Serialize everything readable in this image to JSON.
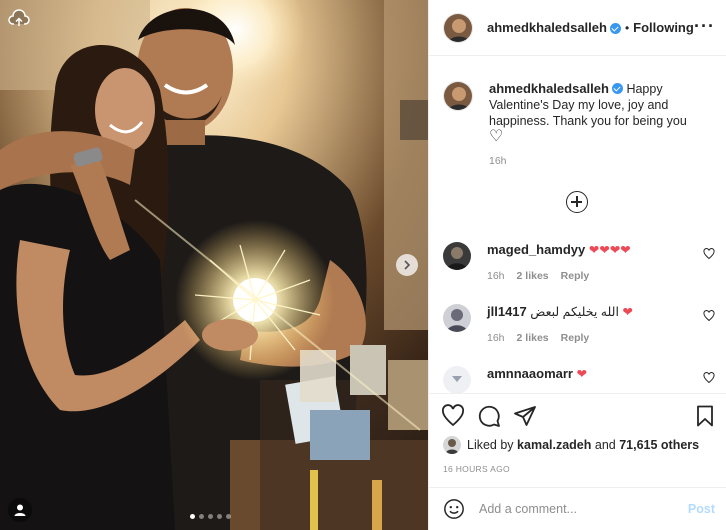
{
  "post": {
    "author": "ahmedkhaledsalleh",
    "follow_status": "Following",
    "more_icon": "more-horizontal-icon",
    "caption": {
      "author": "ahmedkhaledsalleh",
      "text": "Happy Valentine's Day my love, joy and happiness. Thank you for being you",
      "emoji": "♡",
      "time": "16h"
    },
    "load_more_icon": "plus-circle-icon",
    "comments": [
      {
        "author": "maged_hamdyy",
        "text": "",
        "emoji": "❤❤❤❤",
        "time": "16h",
        "likes": "2 likes",
        "reply": "Reply"
      },
      {
        "author": "jll1417",
        "text": "الله يخليكم لبعض",
        "emoji": "❤",
        "time": "16h",
        "likes": "2 likes",
        "reply": "Reply"
      },
      {
        "author": "amnnaaomarr",
        "text": "",
        "emoji": "❤",
        "time": "",
        "likes": "",
        "reply": ""
      }
    ],
    "liked_by_prefix": "Liked by",
    "liked_by_user": "kamal.zadeh",
    "liked_by_and": "and",
    "liked_by_others": "71,615 others",
    "timestamp": "16 HOURS AGO",
    "comment_placeholder": "Add a comment...",
    "post_button": "Post",
    "carousel": {
      "slide_count": 5,
      "current_index": 0
    },
    "icons": {
      "upload": "cloud-upload-icon",
      "next": "chevron-right-icon",
      "tag": "user-tag-icon",
      "like": "heart-icon",
      "comment": "comment-icon",
      "share": "paper-plane-icon",
      "save": "bookmark-icon",
      "emoji": "smiley-icon"
    },
    "colors": {
      "verified": "#3897f0",
      "heart": "#ed4956",
      "muted": "#8e8e8e",
      "post_disabled": "#b3dbff"
    }
  }
}
